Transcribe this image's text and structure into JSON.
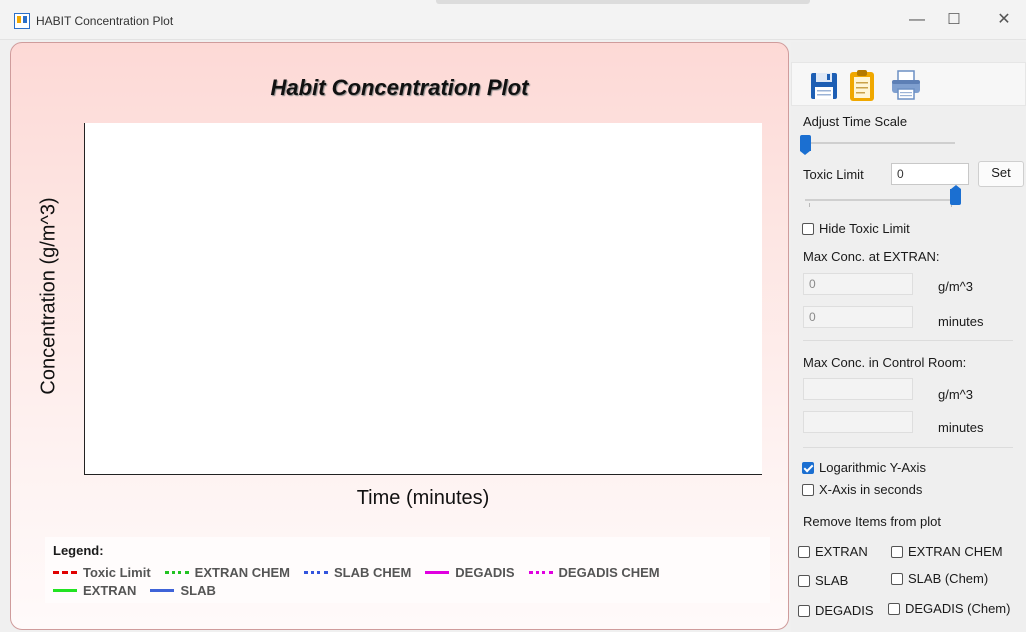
{
  "window": {
    "title": "HABIT Concentration Plot",
    "minimize": "—",
    "maximize": "☐",
    "close": "✕"
  },
  "plot": {
    "title": "Habit Concentration Plot",
    "ylabel": "Concentration (g/m^3)",
    "xlabel": "Time (minutes)",
    "legend_title": "Legend:",
    "legend_items": [
      {
        "label": "Toxic Limit",
        "color": "#e00000",
        "style": "dashed"
      },
      {
        "label": "EXTRAN CHEM",
        "color": "#22c322",
        "style": "dotted"
      },
      {
        "label": "SLAB CHEM",
        "color": "#3355dd",
        "style": "dotted"
      },
      {
        "label": "DEGADIS",
        "color": "#e000e0",
        "style": "solid"
      },
      {
        "label": "DEGADIS CHEM",
        "color": "#e000e0",
        "style": "dotted"
      },
      {
        "label": "EXTRAN",
        "color": "#22e322",
        "style": "solid"
      },
      {
        "label": "SLAB",
        "color": "#3f63d8",
        "style": "solid"
      }
    ]
  },
  "chart_data": {
    "type": "line",
    "title": "Habit Concentration Plot",
    "xlabel": "Time (minutes)",
    "ylabel": "Concentration (g/m^3)",
    "series": [],
    "grid": false,
    "legend": "bottom"
  },
  "toolbar": {
    "save_icon": "save-icon",
    "copy_icon": "clipboard-icon",
    "print_icon": "print-icon"
  },
  "controls": {
    "time_scale_label": "Adjust Time Scale",
    "time_scale_value": 0,
    "toxic_limit_label": "Toxic Limit",
    "toxic_limit_value": "0",
    "set_label": "Set",
    "toxic_slider_value": 1,
    "hide_toxic_label": "Hide Toxic Limit",
    "hide_toxic_checked": false,
    "max_extran_label": "Max Conc. at EXTRAN:",
    "max_extran_conc": "0",
    "max_extran_conc_unit": "g/m^3",
    "max_extran_time": "0",
    "max_extran_time_unit": "minutes",
    "max_control_label": "Max Conc. in Control Room:",
    "max_control_conc": "",
    "max_control_conc_unit": "g/m^3",
    "max_control_time": "",
    "max_control_time_unit": "minutes",
    "log_y_label": "Logarithmic Y-Axis",
    "log_y_checked": true,
    "x_seconds_label": "X-Axis in seconds",
    "x_seconds_checked": false,
    "remove_label": "Remove Items from plot",
    "remove_items": {
      "extran": "EXTRAN",
      "extran_chem": "EXTRAN CHEM",
      "slab": "SLAB",
      "slab_chem": "SLAB (Chem)",
      "degadis": "DEGADIS",
      "degadis_chem": "DEGADIS (Chem)"
    }
  }
}
